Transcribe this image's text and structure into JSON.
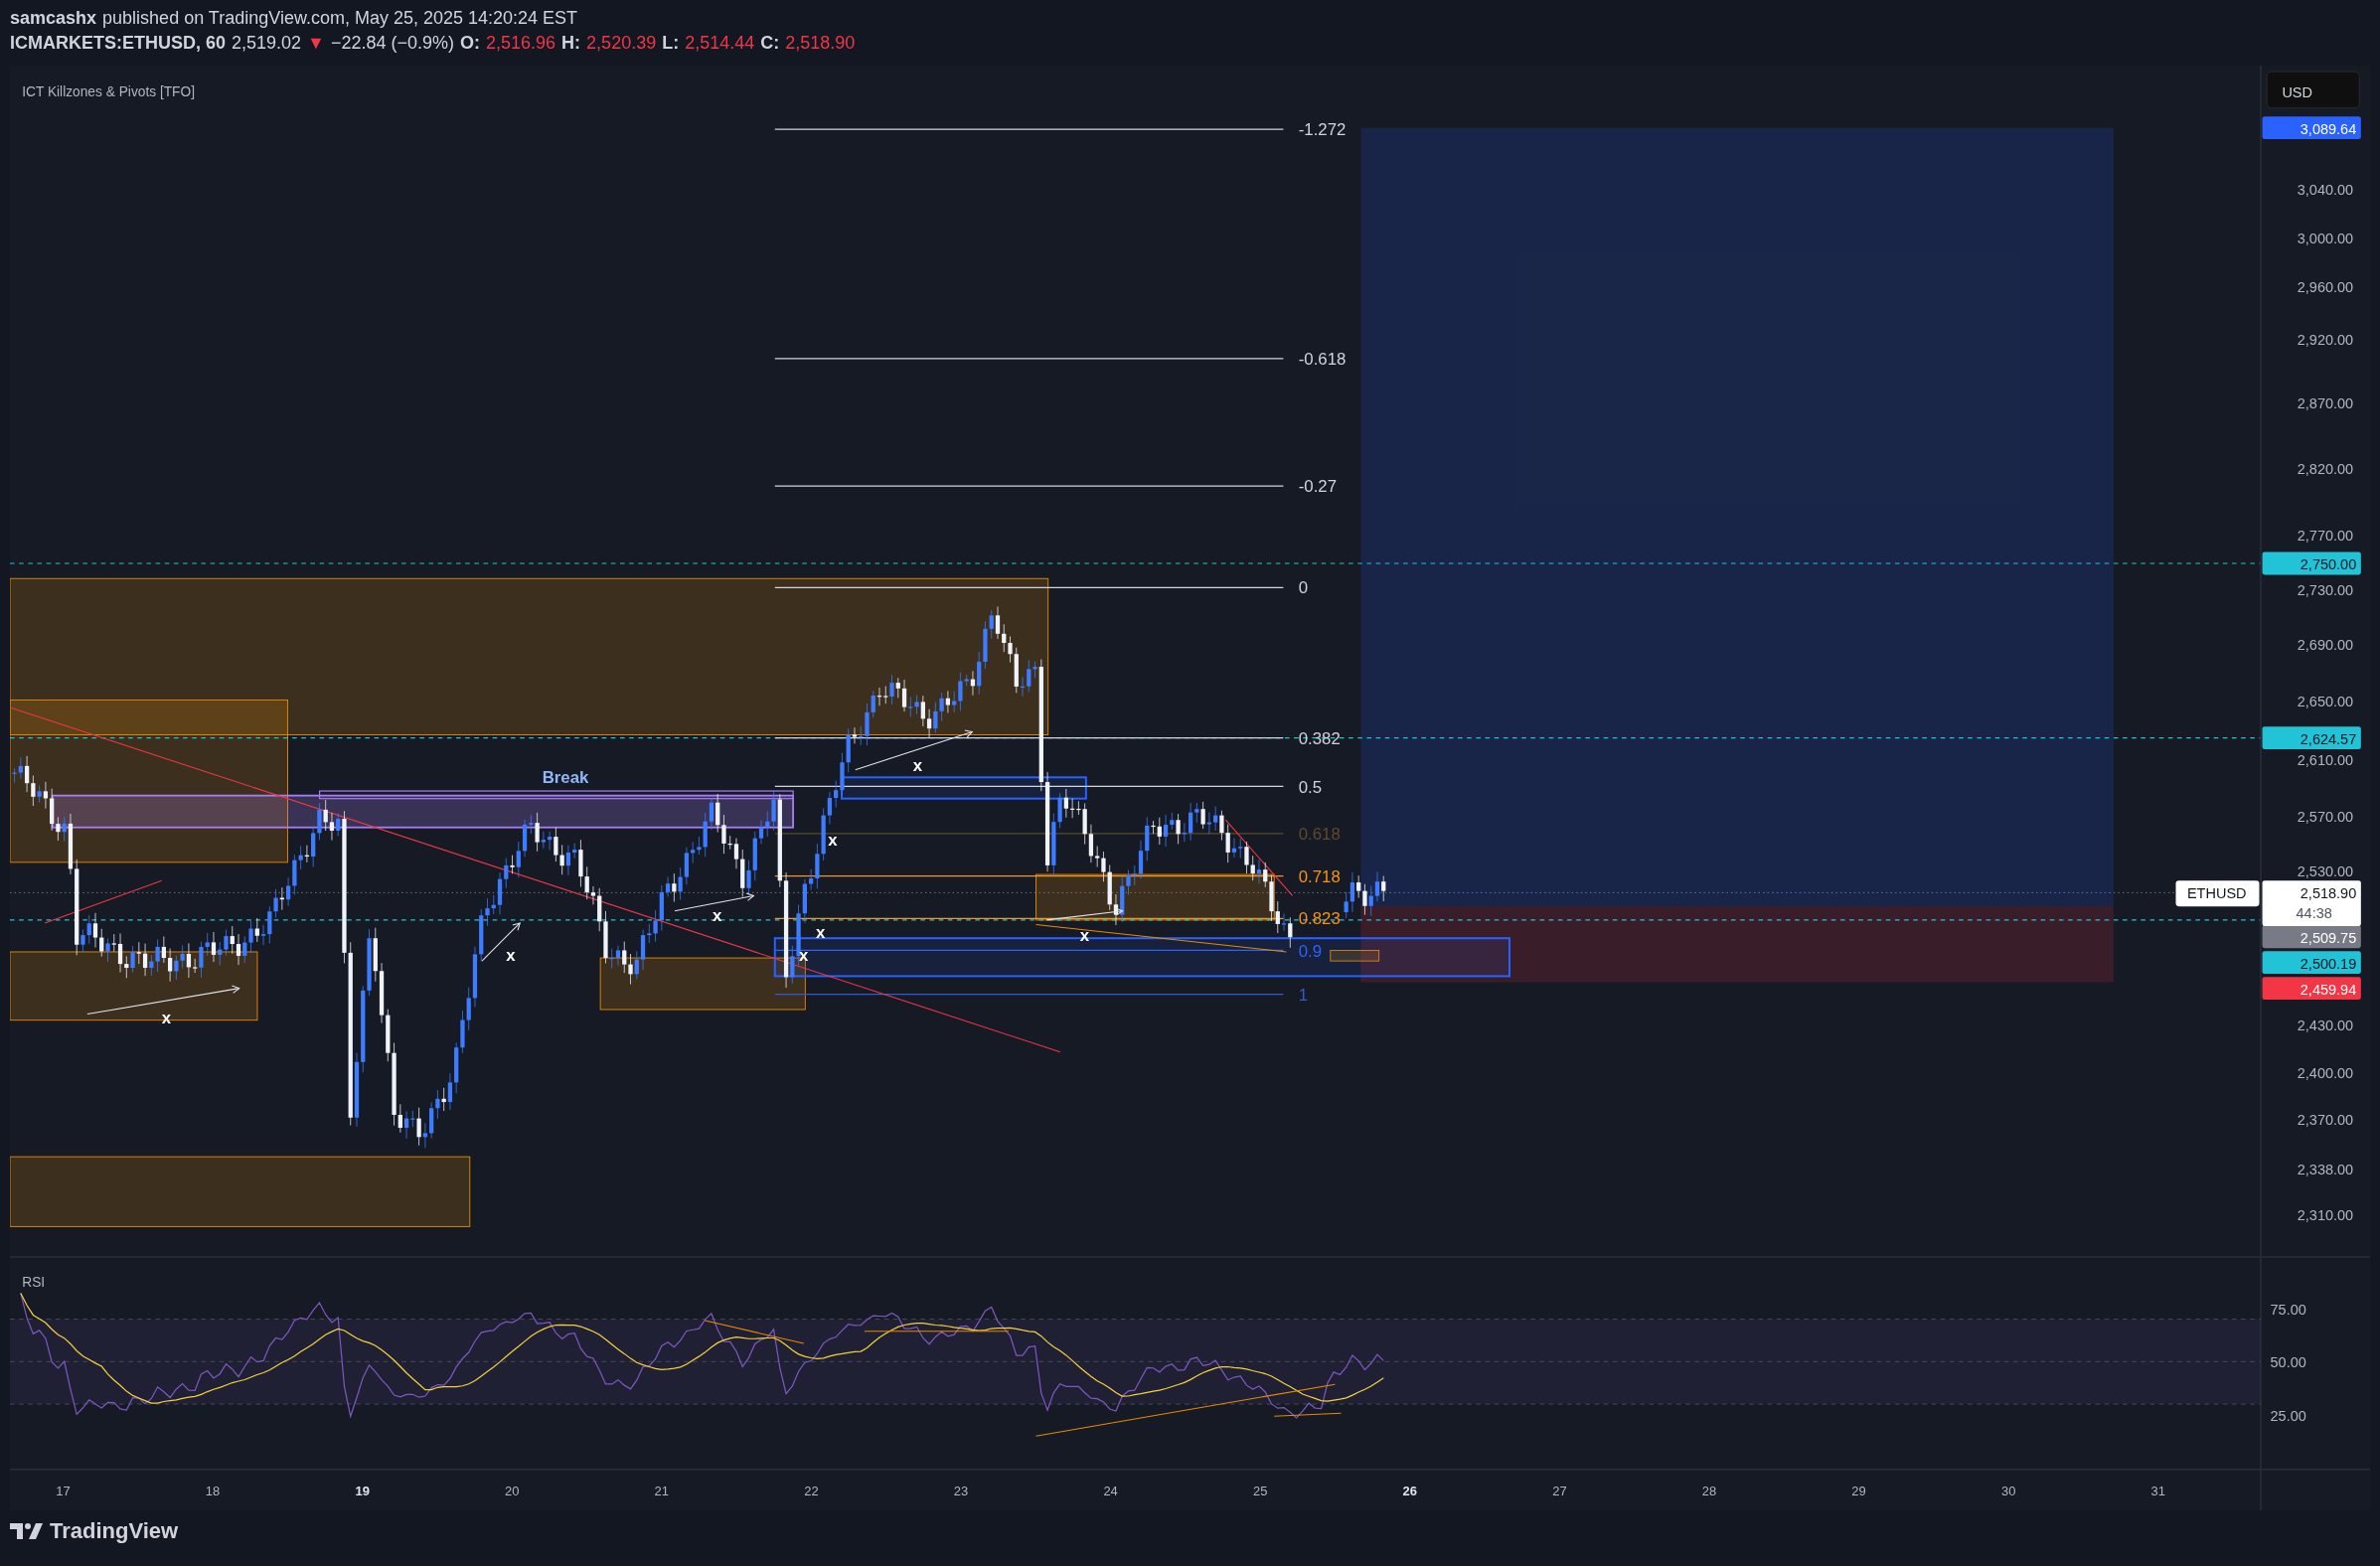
{
  "header": {
    "author": "samcashx",
    "published": "published on TradingView.com, May 25, 2025 14:20:24 EST",
    "symbol": "ICMARKETS:ETHUSD, 60",
    "last": "2,519.02",
    "arrow": "▼",
    "change": "−22.84 (−0.9%)",
    "ohlc": [
      {
        "label": "O:",
        "value": "2,516.96"
      },
      {
        "label": "H:",
        "value": "2,520.39"
      },
      {
        "label": "L:",
        "value": "2,514.44"
      },
      {
        "label": "C:",
        "value": "2,518.90"
      }
    ]
  },
  "indicator_legend": "ICT Killzones & Pivots [TFO]",
  "fib_levels": [
    {
      "label": "-1.272",
      "color": "#d1d4dc"
    },
    {
      "label": "-0.618",
      "color": "#d1d4dc"
    },
    {
      "label": "-0.27",
      "color": "#d1d4dc"
    },
    {
      "label": "0",
      "color": "#d1d4dc"
    },
    {
      "label": "0.382",
      "color": "#d1d4dc"
    },
    {
      "label": "0.5",
      "color": "#d1d4dc"
    },
    {
      "label": "0.618",
      "color": "#5d4a2a"
    },
    {
      "label": "0.718",
      "color": "#f7931a"
    },
    {
      "label": "0.823",
      "color": "#f7931a"
    },
    {
      "label": "0.9",
      "color": "#2962ff"
    },
    {
      "label": "1",
      "color": "#2f5bd0"
    }
  ],
  "break_label": "Break",
  "x_marks": [
    "x",
    "x",
    "x",
    "x",
    "x",
    "x",
    "x",
    "x"
  ],
  "price_axis": {
    "currency": "USD",
    "ticks": [
      "3,040.00",
      "3,000.00",
      "2,960.00",
      "2,920.00",
      "2,870.00",
      "2,820.00",
      "2,770.00",
      "2,730.00",
      "2,690.00",
      "2,650.00",
      "2,610.00",
      "2,570.00",
      "2,530.00",
      "2,430.00",
      "2,400.00",
      "2,370.00",
      "2,338.00",
      "2,310.00"
    ],
    "tags": [
      {
        "text": "3,089.64",
        "color": "#2962ff",
        "kind": "light"
      },
      {
        "text": "2,750.00",
        "color": "#22c3d6",
        "kind": "dark"
      },
      {
        "text": "2,624.57",
        "color": "#22c3d6",
        "kind": "dark"
      },
      {
        "text": "2,509.75",
        "color": "#787b86",
        "kind": "light"
      },
      {
        "text": "2,500.19",
        "color": "#22c3d6",
        "kind": "dark"
      },
      {
        "text": "2,459.94",
        "color": "#f23645",
        "kind": "light"
      }
    ]
  },
  "last_price": {
    "symbol": "ETHUSD",
    "price": "2,518.90",
    "countdown": "44:38"
  },
  "rsi": {
    "label": "RSI",
    "ticks": [
      "75.00",
      "50.00",
      "25.00"
    ]
  },
  "time_axis": [
    {
      "label": "17",
      "bold": false
    },
    {
      "label": "18",
      "bold": false
    },
    {
      "label": "19",
      "bold": true
    },
    {
      "label": "20",
      "bold": false
    },
    {
      "label": "21",
      "bold": false
    },
    {
      "label": "22",
      "bold": false
    },
    {
      "label": "23",
      "bold": false
    },
    {
      "label": "24",
      "bold": false
    },
    {
      "label": "25",
      "bold": false
    },
    {
      "label": "26",
      "bold": true
    },
    {
      "label": "27",
      "bold": false
    },
    {
      "label": "28",
      "bold": false
    },
    {
      "label": "29",
      "bold": false
    },
    {
      "label": "30",
      "bold": false
    },
    {
      "label": "31",
      "bold": false
    }
  ],
  "footer": {
    "brand": "TradingView"
  }
}
